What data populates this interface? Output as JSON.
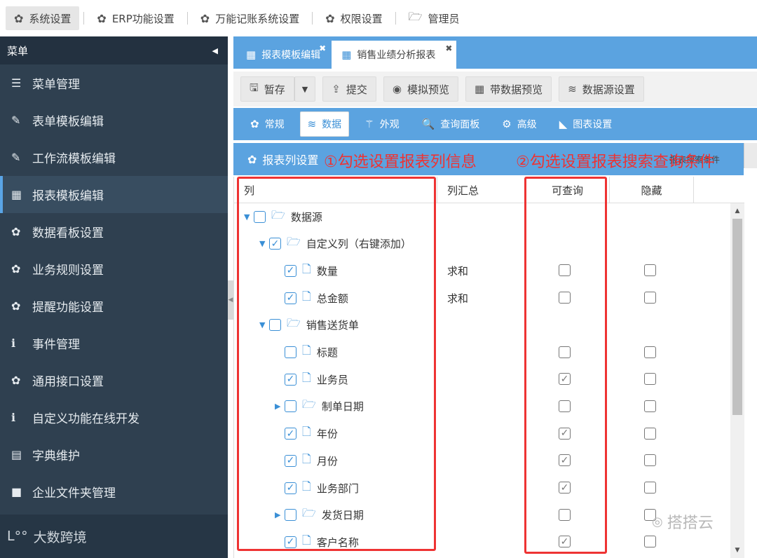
{
  "topbar": {
    "items": [
      {
        "label": "系统设置",
        "icon": "gear-icon"
      },
      {
        "label": "ERP功能设置",
        "icon": "gear-icon"
      },
      {
        "label": "万能记账系统设置",
        "icon": "gear-icon"
      },
      {
        "label": "权限设置",
        "icon": "gear-icon"
      },
      {
        "label": "管理员",
        "icon": "folder-icon"
      }
    ]
  },
  "sidebar": {
    "title": "菜单",
    "items": [
      {
        "label": "菜单管理",
        "icon": "list-icon"
      },
      {
        "label": "表单模板编辑",
        "icon": "edit-icon"
      },
      {
        "label": "工作流模板编辑",
        "icon": "edit-icon"
      },
      {
        "label": "报表模板编辑",
        "icon": "table-icon"
      },
      {
        "label": "数据看板设置",
        "icon": "gear-icon"
      },
      {
        "label": "业务规则设置",
        "icon": "gear-icon"
      },
      {
        "label": "提醒功能设置",
        "icon": "gear-icon"
      },
      {
        "label": "事件管理",
        "icon": "info-icon"
      },
      {
        "label": "通用接口设置",
        "icon": "gear-icon"
      },
      {
        "label": "自定义功能在线开发",
        "icon": "info-icon"
      },
      {
        "label": "字典维护",
        "icon": "keyboard-icon"
      },
      {
        "label": "企业文件夹管理",
        "icon": "folder-icon"
      }
    ],
    "footer": "大数跨境"
  },
  "tabs": [
    {
      "label": "报表模板编辑"
    },
    {
      "label": "销售业绩分析报表"
    }
  ],
  "toolbar": {
    "save": "暂存",
    "submit": "提交",
    "preview": "模拟预览",
    "data_preview": "带数据预览",
    "datasource": "数据源设置"
  },
  "subtabs": [
    "常规",
    "数据",
    "外观",
    "查询面板",
    "高级",
    "图表设置"
  ],
  "section": {
    "title": "报表列设置",
    "behind": "报表搜索条件"
  },
  "grid": {
    "headers": {
      "col": "列",
      "summary": "列汇总",
      "query": "可查询",
      "hidden": "隐藏"
    },
    "rows": [
      {
        "label": "数据源",
        "level": 0,
        "expand": "▼",
        "checked": false,
        "node": "folder",
        "summary": "",
        "cells": false
      },
      {
        "label": "自定义列（右键添加）",
        "level": 1,
        "expand": "▼",
        "checked": true,
        "node": "folder",
        "summary": "",
        "cells": false
      },
      {
        "label": "数量",
        "level": 2,
        "expand": "",
        "checked": true,
        "node": "file",
        "summary": "求和",
        "cells": true,
        "query": false,
        "hidden": false
      },
      {
        "label": "总金额",
        "level": 2,
        "expand": "",
        "checked": true,
        "node": "file",
        "summary": "求和",
        "cells": true,
        "query": false,
        "hidden": false
      },
      {
        "label": "销售送货单",
        "level": 1,
        "expand": "▼",
        "checked": false,
        "node": "folder",
        "summary": "",
        "cells": false
      },
      {
        "label": "标题",
        "level": 2,
        "expand": "",
        "checked": false,
        "node": "file",
        "summary": "",
        "cells": true,
        "query": false,
        "hidden": false
      },
      {
        "label": "业务员",
        "level": 2,
        "expand": "",
        "checked": true,
        "node": "file",
        "summary": "",
        "cells": true,
        "query": true,
        "hidden": false
      },
      {
        "label": "制单日期",
        "level": 2,
        "expand": "▶",
        "checked": false,
        "node": "folder",
        "summary": "",
        "cells": true,
        "query": false,
        "hidden": false
      },
      {
        "label": "年份",
        "level": 2,
        "expand": "",
        "checked": true,
        "node": "file",
        "summary": "",
        "cells": true,
        "query": true,
        "hidden": false
      },
      {
        "label": "月份",
        "level": 2,
        "expand": "",
        "checked": true,
        "node": "file",
        "summary": "",
        "cells": true,
        "query": true,
        "hidden": false
      },
      {
        "label": "业务部门",
        "level": 2,
        "expand": "",
        "checked": true,
        "node": "file",
        "summary": "",
        "cells": true,
        "query": true,
        "hidden": false
      },
      {
        "label": "发货日期",
        "level": 2,
        "expand": "▶",
        "checked": false,
        "node": "folder",
        "summary": "",
        "cells": true,
        "query": false,
        "hidden": false
      },
      {
        "label": "客户名称",
        "level": 2,
        "expand": "",
        "checked": true,
        "node": "file",
        "summary": "",
        "cells": true,
        "query": true,
        "hidden": false
      }
    ]
  },
  "annotations": {
    "note1": "①勾选设置报表列信息",
    "note2": "②勾选设置报表搜索查询条件"
  },
  "watermark": "搭搭云",
  "colors": {
    "accent": "#5ba3e0",
    "sidebar": "#2f4050",
    "annotation": "#e33333"
  }
}
